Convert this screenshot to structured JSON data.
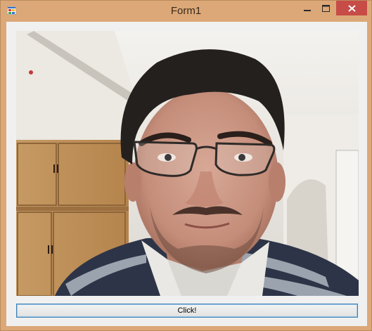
{
  "window": {
    "title": "Form1"
  },
  "icons": {
    "app": "app-icon",
    "minimize": "minimize-icon",
    "maximize": "maximize-icon",
    "close": "close-icon"
  },
  "colors": {
    "frame": "#dca878",
    "close_button": "#c74c47",
    "client_background": "#f0f0f0",
    "button_border": "#3c7fb1"
  },
  "main": {
    "picture_content": "webcam-photo",
    "button_label": "Click!"
  }
}
